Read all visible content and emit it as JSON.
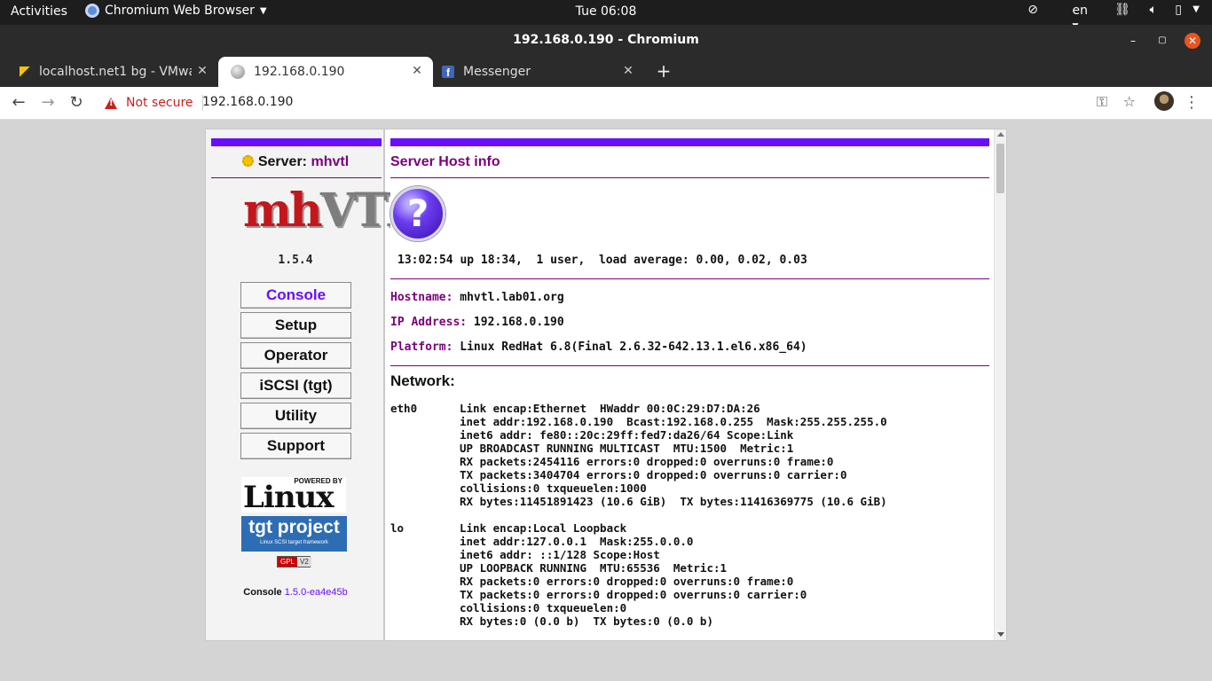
{
  "topbar": {
    "activities": "Activities",
    "app_name": "Chromium Web Browser",
    "clock": "Tue 06:08",
    "lang": "en"
  },
  "window": {
    "title": "192.168.0.190 - Chromium"
  },
  "tabs": [
    {
      "label": "localhost.net1 bg - VMwa",
      "active": false
    },
    {
      "label": "192.168.0.190",
      "active": true
    },
    {
      "label": "Messenger",
      "active": false
    }
  ],
  "nav": {
    "security_label": "Not secure",
    "url": "192.168.0.190"
  },
  "left": {
    "server_label": "Server:",
    "server_name": "mhvtl",
    "logo_part1": "mh",
    "logo_part2": "VTL",
    "version": "1.5.4",
    "menu": [
      "Console",
      "Setup",
      "Operator",
      "iSCSI (tgt)",
      "Utility",
      "Support"
    ],
    "powered_by": "POWERED BY",
    "linux_logo": "Linux",
    "tgt_title": "tgt project",
    "tgt_sub": "Linux SCSI target framework",
    "gpl_a": "GPL",
    "gpl_b": "V2",
    "console_label": "Console",
    "console_version": "1.5.0-ea4e45b"
  },
  "main": {
    "title": "Server Host info",
    "uptime": "13:02:54 up 18:34,  1 user,  load average: 0.00, 0.02, 0.03",
    "hostname_label": "Hostname:",
    "hostname": "mhvtl.lab01.org",
    "ip_label": "IP Address:",
    "ip": "192.168.0.190",
    "platform_label": "Platform:",
    "platform": "Linux RedHat 6.8(Final 2.6.32-642.13.1.el6.x86_64)",
    "network_heading": "Network:",
    "interfaces": [
      {
        "name": "eth0",
        "lines": [
          "Link encap:Ethernet  HWaddr 00:0C:29:D7:DA:26",
          "inet addr:192.168.0.190  Bcast:192.168.0.255  Mask:255.255.255.0",
          "inet6 addr: fe80::20c:29ff:fed7:da26/64 Scope:Link",
          "UP BROADCAST RUNNING MULTICAST  MTU:1500  Metric:1",
          "RX packets:2454116 errors:0 dropped:0 overruns:0 frame:0",
          "TX packets:3404704 errors:0 dropped:0 overruns:0 carrier:0",
          "collisions:0 txqueuelen:1000",
          "RX bytes:11451891423 (10.6 GiB)  TX bytes:11416369775 (10.6 GiB)"
        ]
      },
      {
        "name": "lo",
        "lines": [
          "Link encap:Local Loopback",
          "inet addr:127.0.0.1  Mask:255.0.0.0",
          "inet6 addr: ::1/128 Scope:Host",
          "UP LOOPBACK RUNNING  MTU:65536  Metric:1",
          "RX packets:0 errors:0 dropped:0 overruns:0 frame:0",
          "TX packets:0 errors:0 dropped:0 overruns:0 carrier:0",
          "collisions:0 txqueuelen:0",
          "RX bytes:0 (0.0 b)  TX bytes:0 (0.0 b)"
        ]
      }
    ]
  },
  "colors": {
    "accent_purple": "#6a0dff",
    "heading_plum": "#7a007a",
    "ubuntu_orange": "#e95420",
    "not_secure_red": "#c5221f"
  }
}
